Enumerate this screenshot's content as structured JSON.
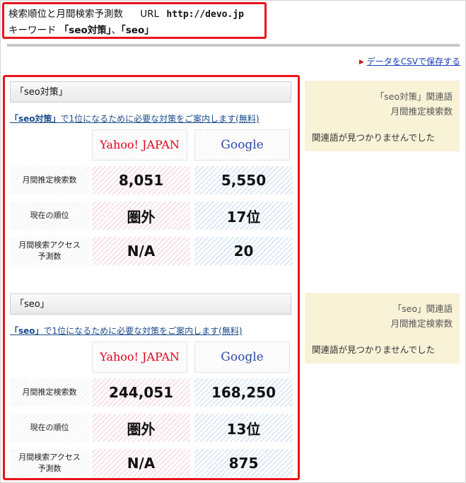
{
  "header": {
    "title": "検索順位と月間検索予測数",
    "url_label": "URL",
    "url": "http://devo.jp",
    "keyword_prefix": "キーワード",
    "keyword_1": "「seo対策」",
    "separator": "、",
    "keyword_2": "「seo」"
  },
  "csv_link": "データをCSVで保存する",
  "engines": {
    "yahoo": "Yahoo! JAPAN",
    "google": "Google"
  },
  "row_labels": {
    "monthly": "月間推定検索数",
    "rank": "現在の順位",
    "access_1": "月間検索アクセス",
    "access_2": "予測数"
  },
  "sections": [
    {
      "title": "「seo対策」",
      "link_kw": "「seo対策」",
      "link_rest": "で1位になるために必要な対策をご案内します(無料)",
      "monthly": {
        "yahoo": "8,051",
        "google": "5,550"
      },
      "rank": {
        "yahoo": "圏外",
        "google": "17位"
      },
      "access": {
        "yahoo": "N/A",
        "google": "20"
      }
    },
    {
      "title": "「seo」",
      "link_kw": "「seo」",
      "link_rest": "で1位になるために必要な対策をご案内します(無料)",
      "monthly": {
        "yahoo": "244,051",
        "google": "168,250"
      },
      "rank": {
        "yahoo": "圏外",
        "google": "13位"
      },
      "access": {
        "yahoo": "N/A",
        "google": "875"
      }
    }
  ],
  "related": [
    {
      "kw": "「seo対策」",
      "title_suffix": "関連語",
      "subtitle": "月間推定検索数",
      "message": "関連語が見つかりませんでした"
    },
    {
      "kw": "「seo」",
      "title_suffix": "関連語",
      "subtitle": "月間推定検索数",
      "message": "関連語が見つかりませんでした"
    }
  ],
  "colors": {
    "highlight_border": "#e8141c",
    "link": "#1a4b8c",
    "yahoo": "#e0001a",
    "google": "#2a49a8",
    "related_bg": "#f8f2d7"
  }
}
